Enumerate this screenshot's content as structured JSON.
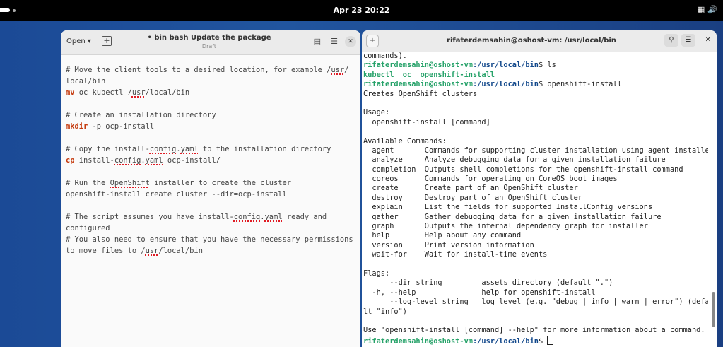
{
  "topbar": {
    "clock": "Apr 23  20:22",
    "tray_icons": [
      "network-icon",
      "volume-icon"
    ]
  },
  "gedit": {
    "open_label": "Open",
    "title": "• bin bash Update the package",
    "subtitle": "Draft",
    "lines": [
      {
        "t": "# Move the client tools to a desired location, for example /usr/"
      },
      {
        "t": "local/bin"
      },
      {
        "cmd": "mv",
        "t": " oc kubectl /usr/local/bin"
      },
      {
        "t": ""
      },
      {
        "t": "# Create an installation directory"
      },
      {
        "cmd": "mkdir",
        "t": " -p ocp-install"
      },
      {
        "t": ""
      },
      {
        "t": "# Copy the install-config.yaml to the installation directory"
      },
      {
        "cmd": "cp",
        "t": " install-config.yaml ocp-install/"
      },
      {
        "t": ""
      },
      {
        "t": "# Run the OpenShift installer to create the cluster"
      },
      {
        "t": "openshift-install create cluster --dir=ocp-install"
      },
      {
        "t": ""
      },
      {
        "t": "# The script assumes you have install-config.yaml ready and"
      },
      {
        "t": "configured"
      },
      {
        "t": "# You also need to ensure that you have the necessary permissions"
      },
      {
        "t": "to move files to /usr/local/bin"
      }
    ]
  },
  "terminal": {
    "title": "rifaterdemsahin@oshost-vm: /usr/local/bin",
    "prompt_user": "rifaterdemsahin@oshost-vm",
    "prompt_path": ":/usr/local/bin",
    "lines": [
      {
        "t": "commands)."
      },
      {
        "p": true,
        "t": "$ ls"
      },
      {
        "g": "kubectl  oc  openshift-install"
      },
      {
        "p": true,
        "t": "$ openshift-install"
      },
      {
        "t": "Creates OpenShift clusters"
      },
      {
        "t": ""
      },
      {
        "t": "Usage:"
      },
      {
        "t": "  openshift-install [command]"
      },
      {
        "t": ""
      },
      {
        "t": "Available Commands:"
      },
      {
        "t": "  agent       Commands for supporting cluster installation using agent installer"
      },
      {
        "t": "  analyze     Analyze debugging data for a given installation failure"
      },
      {
        "t": "  completion  Outputs shell completions for the openshift-install command"
      },
      {
        "t": "  coreos      Commands for operating on CoreOS boot images"
      },
      {
        "t": "  create      Create part of an OpenShift cluster"
      },
      {
        "t": "  destroy     Destroy part of an OpenShift cluster"
      },
      {
        "t": "  explain     List the fields for supported InstallConfig versions"
      },
      {
        "t": "  gather      Gather debugging data for a given installation failure"
      },
      {
        "t": "  graph       Outputs the internal dependency graph for installer"
      },
      {
        "t": "  help        Help about any command"
      },
      {
        "t": "  version     Print version information"
      },
      {
        "t": "  wait-for    Wait for install-time events"
      },
      {
        "t": ""
      },
      {
        "t": "Flags:"
      },
      {
        "t": "      --dir string         assets directory (default \".\")"
      },
      {
        "t": "  -h, --help               help for openshift-install"
      },
      {
        "t": "      --log-level string   log level (e.g. \"debug | info | warn | error\") (defau"
      },
      {
        "t": "lt \"info\")"
      },
      {
        "t": ""
      },
      {
        "t": "Use \"openshift-install [command] --help\" for more information about a command."
      },
      {
        "p": true,
        "t": "$ ",
        "cursor": true
      }
    ]
  }
}
